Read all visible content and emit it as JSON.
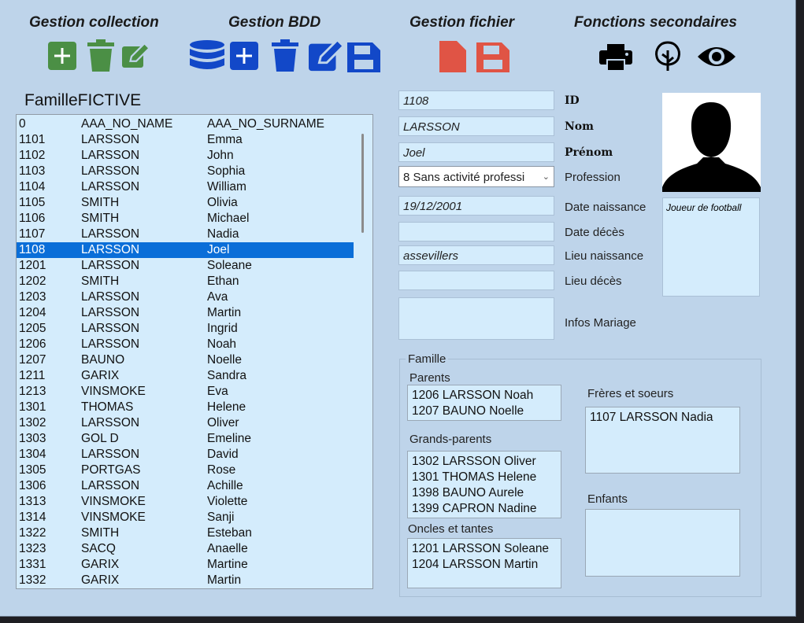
{
  "toolbar": {
    "sections": [
      {
        "title": "Gestion collection"
      },
      {
        "title": "Gestion BDD"
      },
      {
        "title": "Gestion fichier"
      },
      {
        "title": "Fonctions secondaires"
      }
    ],
    "colors": {
      "green": "#4b8f45",
      "blue": "#1248c8",
      "red": "#e05445",
      "black": "#000000"
    }
  },
  "collection": {
    "name": "FamilleFICTIVE",
    "rows": [
      {
        "id": "0",
        "nom": "AAA_NO_NAME",
        "prenom": "AAA_NO_SURNAME"
      },
      {
        "id": "1101",
        "nom": "LARSSON",
        "prenom": "Emma"
      },
      {
        "id": "1102",
        "nom": "LARSSON",
        "prenom": "John"
      },
      {
        "id": "1103",
        "nom": "LARSSON",
        "prenom": "Sophia"
      },
      {
        "id": "1104",
        "nom": "LARSSON",
        "prenom": "William"
      },
      {
        "id": "1105",
        "nom": "SMITH",
        "prenom": "Olivia"
      },
      {
        "id": "1106",
        "nom": "SMITH",
        "prenom": "Michael"
      },
      {
        "id": "1107",
        "nom": "LARSSON",
        "prenom": "Nadia"
      },
      {
        "id": "1108",
        "nom": "LARSSON",
        "prenom": "Joel"
      },
      {
        "id": "1201",
        "nom": "LARSSON",
        "prenom": "Soleane"
      },
      {
        "id": "1202",
        "nom": "SMITH",
        "prenom": "Ethan"
      },
      {
        "id": "1203",
        "nom": "LARSSON",
        "prenom": "Ava"
      },
      {
        "id": "1204",
        "nom": "LARSSON",
        "prenom": "Martin"
      },
      {
        "id": "1205",
        "nom": "LARSSON",
        "prenom": "Ingrid"
      },
      {
        "id": "1206",
        "nom": "LARSSON",
        "prenom": "Noah"
      },
      {
        "id": "1207",
        "nom": "BAUNO",
        "prenom": "Noelle"
      },
      {
        "id": "1211",
        "nom": "GARIX",
        "prenom": "Sandra"
      },
      {
        "id": "1213",
        "nom": "VINSMOKE",
        "prenom": "Eva"
      },
      {
        "id": "1301",
        "nom": "THOMAS",
        "prenom": "Helene"
      },
      {
        "id": "1302",
        "nom": "LARSSON",
        "prenom": "Oliver"
      },
      {
        "id": "1303",
        "nom": "GOL D",
        "prenom": "Emeline"
      },
      {
        "id": "1304",
        "nom": "LARSSON",
        "prenom": "David"
      },
      {
        "id": "1305",
        "nom": "PORTGAS",
        "prenom": "Rose"
      },
      {
        "id": "1306",
        "nom": "LARSSON",
        "prenom": "Achille"
      },
      {
        "id": "1313",
        "nom": "VINSMOKE",
        "prenom": "Violette"
      },
      {
        "id": "1314",
        "nom": "VINSMOKE",
        "prenom": "Sanji"
      },
      {
        "id": "1322",
        "nom": "SMITH",
        "prenom": "Esteban"
      },
      {
        "id": "1323",
        "nom": "SACQ",
        "prenom": "Anaelle"
      },
      {
        "id": "1331",
        "nom": "GARIX",
        "prenom": "Martine"
      },
      {
        "id": "1332",
        "nom": "GARIX",
        "prenom": "Martin"
      }
    ],
    "selected_id": "1108"
  },
  "person": {
    "id": {
      "value": "1108",
      "label": "ID"
    },
    "nom": {
      "value": "LARSSON",
      "label": "Nom"
    },
    "prenom": {
      "value": "Joel",
      "label": "Prénom"
    },
    "profession": {
      "value": "8 Sans activité professi",
      "label": "Profession"
    },
    "date_naissance": {
      "value": "19/12/2001",
      "label": "Date naissance"
    },
    "date_deces": {
      "value": "",
      "label": "Date décès"
    },
    "lieu_naissance": {
      "value": "assevillers",
      "label": "Lieu naissance"
    },
    "lieu_deces": {
      "value": "",
      "label": "Lieu décès"
    },
    "infos_mariage": {
      "value": "",
      "label": "Infos Mariage"
    },
    "note": "Joueur de football"
  },
  "famille": {
    "title": "Famille",
    "parents": {
      "label": "Parents",
      "items": [
        "1206 LARSSON Noah",
        "1207 BAUNO Noelle"
      ]
    },
    "grands_parents": {
      "label": "Grands-parents",
      "items": [
        "1302 LARSSON Oliver",
        "1301 THOMAS Helene",
        "1398 BAUNO Aurele",
        "1399 CAPRON Nadine"
      ]
    },
    "oncles_tantes": {
      "label": "Oncles et tantes",
      "items": [
        "1201 LARSSON Soleane",
        "1204 LARSSON Martin"
      ]
    },
    "freres_soeurs": {
      "label": "Frères et soeurs",
      "items": [
        "1107 LARSSON Nadia"
      ]
    },
    "enfants": {
      "label": "Enfants",
      "items": []
    }
  }
}
